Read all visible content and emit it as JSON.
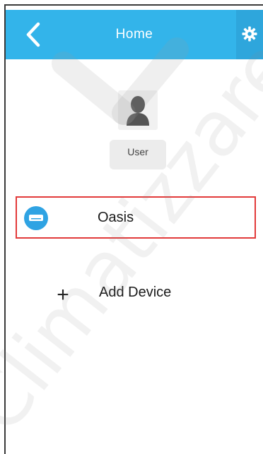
{
  "header": {
    "title": "Home",
    "back_icon": "chevron-left-icon",
    "settings_icon": "gear-icon",
    "color": "#33b4ea"
  },
  "user": {
    "label": "User",
    "icon": "person-icon"
  },
  "devices": [
    {
      "name": "Oasis",
      "icon": "air-conditioner-icon",
      "icon_color": "#2fa3e3",
      "highlight_color": "#e23a3a"
    }
  ],
  "add_device": {
    "symbol": "+",
    "label": "Add Device"
  },
  "watermark": {
    "text": "Climatizzare"
  }
}
